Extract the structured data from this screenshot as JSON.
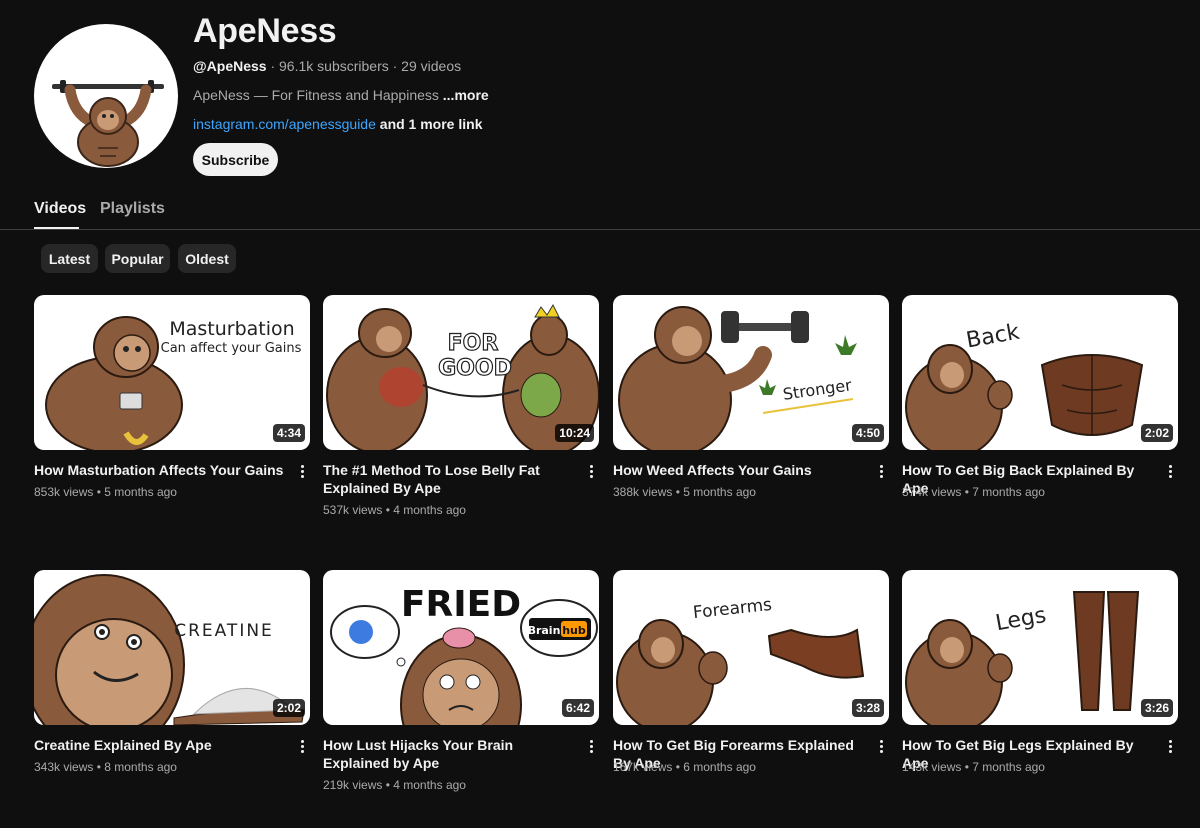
{
  "channel": {
    "name": "ApeNess",
    "handle": "@ApeNess",
    "stats_suffix": " · 96.1k subscribers · 29 videos",
    "description": "ApeNess — For Fitness and Happiness ",
    "description_more": "...more",
    "link": "instagram.com/apenessguide",
    "more_links": " and 1 more link",
    "subscribe_label": "Subscribe"
  },
  "tabs": [
    {
      "label": "Videos"
    },
    {
      "label": "Playlists"
    }
  ],
  "chips": [
    {
      "label": "Latest"
    },
    {
      "label": "Popular"
    },
    {
      "label": "Oldest"
    }
  ],
  "videos": [
    {
      "title": "How Masturbation Affects Your Gains",
      "views": "853k views",
      "age": "5 months ago",
      "duration": "4:34",
      "thumb_text": [
        "Masturbation",
        "Can affect your Gains"
      ]
    },
    {
      "title": "The #1 Method To Lose Belly Fat Explained By Ape",
      "views": "537k views",
      "age": "4 months ago",
      "duration": "10:24",
      "thumb_text": [
        "FOR",
        "GOOD"
      ]
    },
    {
      "title": "How Weed Affects Your Gains",
      "views": "388k views",
      "age": "5 months ago",
      "duration": "4:50",
      "thumb_text": [
        "Stronger"
      ]
    },
    {
      "title": "How To Get Big Back Explained By Ape",
      "views": "374k views",
      "age": "7 months ago",
      "duration": "2:02",
      "thumb_text": [
        "Back"
      ]
    },
    {
      "title": "Creatine Explained By Ape",
      "views": "343k views",
      "age": "8 months ago",
      "duration": "2:02",
      "thumb_text": [
        "CREATINE"
      ]
    },
    {
      "title": "How Lust Hijacks Your Brain Explained by Ape",
      "views": "219k views",
      "age": "4 months ago",
      "duration": "6:42",
      "thumb_text": [
        "FRIED",
        "Brain",
        "hub"
      ]
    },
    {
      "title": "How To Get Big Forearms Explained By Ape",
      "views": "167k views",
      "age": "6 months ago",
      "duration": "3:28",
      "thumb_text": [
        "Forearms"
      ]
    },
    {
      "title": "How To Get Big Legs Explained By Ape",
      "views": "143k views",
      "age": "7 months ago",
      "duration": "3:26",
      "thumb_text": [
        "Legs"
      ]
    }
  ],
  "icons": {
    "menu": "more-vert-icon",
    "avatar": "ape-lifting-bar-logo"
  },
  "colors": {
    "background": "#0f0f0f",
    "link": "#3ea6ff",
    "ape_brown": "#8a5a3c",
    "ape_face": "#c99a76"
  }
}
